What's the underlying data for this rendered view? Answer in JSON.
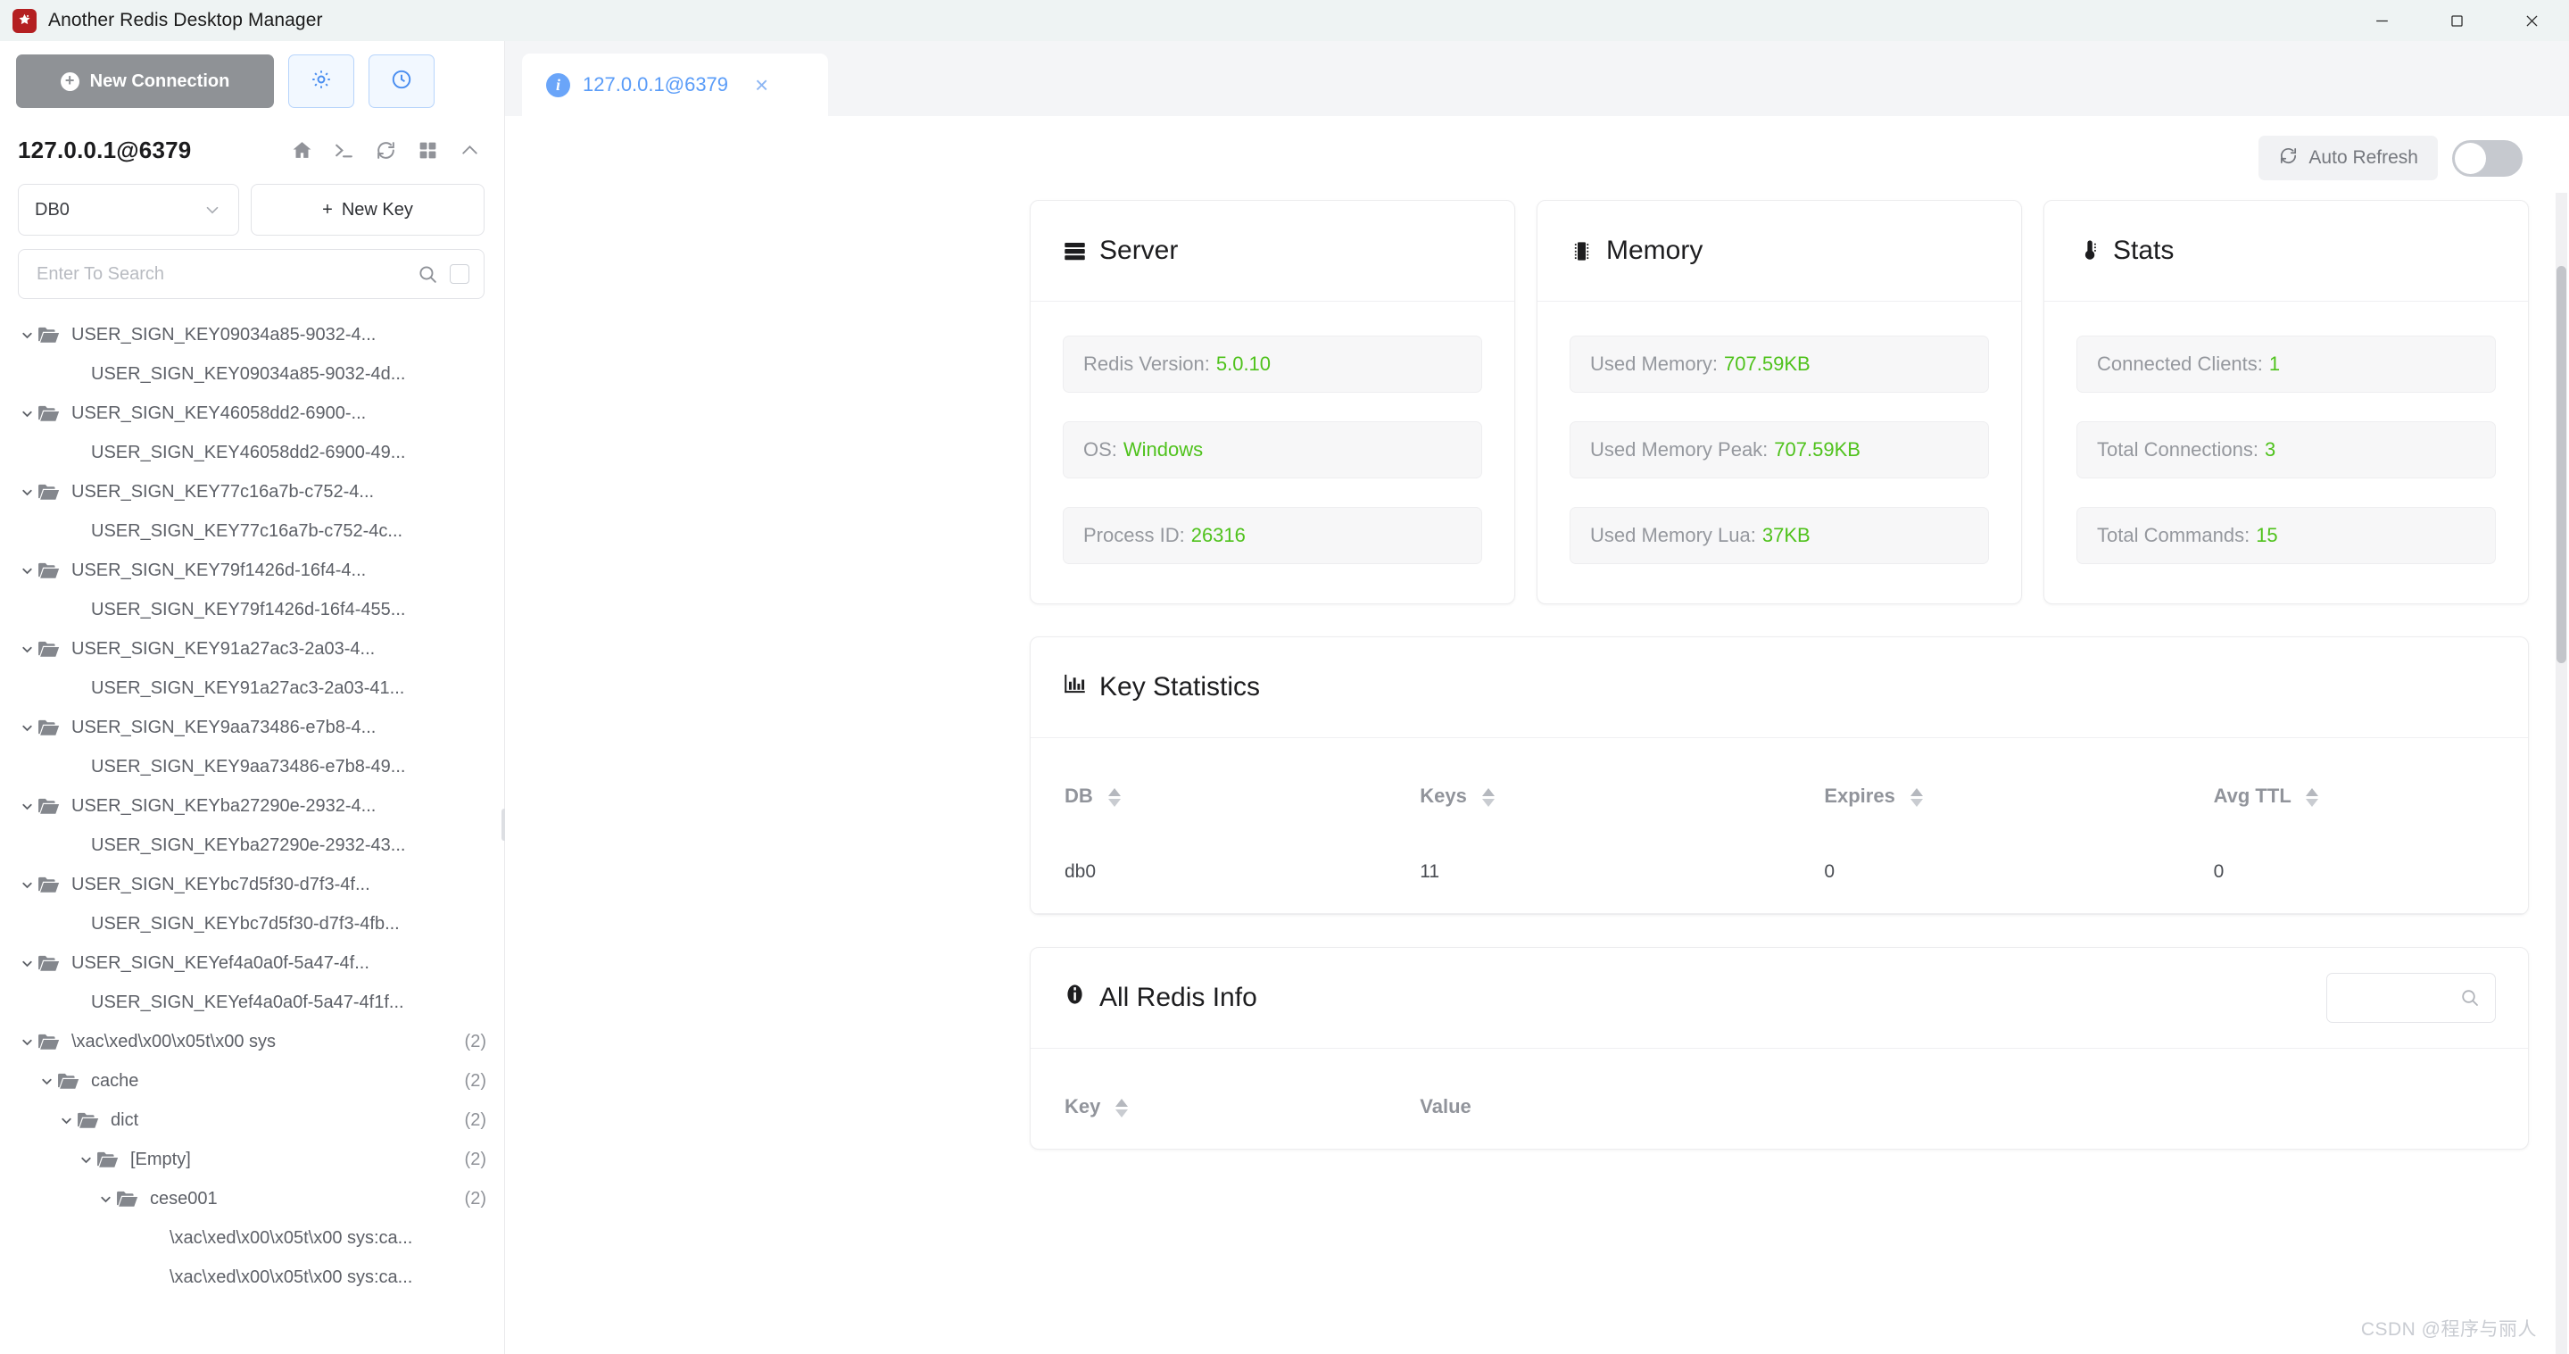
{
  "window": {
    "title": "Another Redis Desktop Manager",
    "controls": {
      "minimize": "minimize-icon",
      "maximize": "maximize-icon",
      "close": "close-icon"
    }
  },
  "sidebar": {
    "new_connection_label": "New Connection",
    "settings_icon": "settings-gear-icon",
    "history_icon": "clock-history-icon",
    "connection_name": "127.0.0.1@6379",
    "connection_icons": [
      "home-icon",
      "console-icon",
      "refresh-icon",
      "grid-icon",
      "chevron-up-icon"
    ],
    "db_selected": "DB0",
    "new_key_label": "New Key",
    "search_placeholder": "Enter To Search",
    "search_value": "",
    "tree": [
      {
        "label": "USER_SIGN_KEY09034a85-9032-4...",
        "type": "folder",
        "depth": 0,
        "expanded": true,
        "count": ""
      },
      {
        "label": "USER_SIGN_KEY09034a85-9032-4d...",
        "type": "key",
        "depth": 1,
        "expanded": false,
        "count": ""
      },
      {
        "label": "USER_SIGN_KEY46058dd2-6900-...",
        "type": "folder",
        "depth": 0,
        "expanded": true,
        "count": ""
      },
      {
        "label": "USER_SIGN_KEY46058dd2-6900-49...",
        "type": "key",
        "depth": 1,
        "expanded": false,
        "count": ""
      },
      {
        "label": "USER_SIGN_KEY77c16a7b-c752-4...",
        "type": "folder",
        "depth": 0,
        "expanded": true,
        "count": ""
      },
      {
        "label": "USER_SIGN_KEY77c16a7b-c752-4c...",
        "type": "key",
        "depth": 1,
        "expanded": false,
        "count": ""
      },
      {
        "label": "USER_SIGN_KEY79f1426d-16f4-4...",
        "type": "folder",
        "depth": 0,
        "expanded": true,
        "count": ""
      },
      {
        "label": "USER_SIGN_KEY79f1426d-16f4-455...",
        "type": "key",
        "depth": 1,
        "expanded": false,
        "count": ""
      },
      {
        "label": "USER_SIGN_KEY91a27ac3-2a03-4...",
        "type": "folder",
        "depth": 0,
        "expanded": true,
        "count": ""
      },
      {
        "label": "USER_SIGN_KEY91a27ac3-2a03-41...",
        "type": "key",
        "depth": 1,
        "expanded": false,
        "count": ""
      },
      {
        "label": "USER_SIGN_KEY9aa73486-e7b8-4...",
        "type": "folder",
        "depth": 0,
        "expanded": true,
        "count": ""
      },
      {
        "label": "USER_SIGN_KEY9aa73486-e7b8-49...",
        "type": "key",
        "depth": 1,
        "expanded": false,
        "count": ""
      },
      {
        "label": "USER_SIGN_KEYba27290e-2932-4...",
        "type": "folder",
        "depth": 0,
        "expanded": true,
        "count": ""
      },
      {
        "label": "USER_SIGN_KEYba27290e-2932-43...",
        "type": "key",
        "depth": 1,
        "expanded": false,
        "count": ""
      },
      {
        "label": "USER_SIGN_KEYbc7d5f30-d7f3-4f...",
        "type": "folder",
        "depth": 0,
        "expanded": true,
        "count": ""
      },
      {
        "label": "USER_SIGN_KEYbc7d5f30-d7f3-4fb...",
        "type": "key",
        "depth": 1,
        "expanded": false,
        "count": ""
      },
      {
        "label": "USER_SIGN_KEYef4a0a0f-5a47-4f...",
        "type": "folder",
        "depth": 0,
        "expanded": true,
        "count": ""
      },
      {
        "label": "USER_SIGN_KEYef4a0a0f-5a47-4f1f...",
        "type": "key",
        "depth": 1,
        "expanded": false,
        "count": ""
      },
      {
        "label": "\\xac\\xed\\x00\\x05t\\x00 sys",
        "type": "folder",
        "depth": 0,
        "expanded": true,
        "count": "(2)"
      },
      {
        "label": "cache",
        "type": "folder",
        "depth": 1,
        "expanded": true,
        "count": "(2)"
      },
      {
        "label": "dict",
        "type": "folder",
        "depth": 2,
        "expanded": true,
        "count": "(2)"
      },
      {
        "label": "[Empty]",
        "type": "folder",
        "depth": 3,
        "expanded": true,
        "count": "(2)"
      },
      {
        "label": "cese001",
        "type": "folder",
        "depth": 4,
        "expanded": true,
        "count": "(2)"
      },
      {
        "label": "\\xac\\xed\\x00\\x05t\\x00 sys:ca...",
        "type": "key",
        "depth": 5,
        "expanded": false,
        "count": ""
      },
      {
        "label": "\\xac\\xed\\x00\\x05t\\x00 sys:ca...",
        "type": "key",
        "depth": 5,
        "expanded": false,
        "count": ""
      }
    ]
  },
  "tabs": [
    {
      "label": "127.0.0.1@6379",
      "icon": "info-icon",
      "close": "×",
      "active": true
    }
  ],
  "toolbar": {
    "auto_refresh_label": "Auto Refresh",
    "auto_refresh_icon": "refresh-icon",
    "auto_refresh_on": false
  },
  "cards": [
    {
      "title": "Server",
      "icon": "server-icon",
      "rows": [
        {
          "label": "Redis Version:",
          "value": "5.0.10"
        },
        {
          "label": "OS:",
          "value": "Windows"
        },
        {
          "label": "Process ID:",
          "value": "26316"
        }
      ]
    },
    {
      "title": "Memory",
      "icon": "memory-chip-icon",
      "rows": [
        {
          "label": "Used Memory:",
          "value": "707.59KB"
        },
        {
          "label": "Used Memory Peak:",
          "value": "707.59KB"
        },
        {
          "label": "Used Memory Lua:",
          "value": "37KB"
        }
      ]
    },
    {
      "title": "Stats",
      "icon": "thermometer-icon",
      "rows": [
        {
          "label": "Connected Clients:",
          "value": "1"
        },
        {
          "label": "Total Connections:",
          "value": "3"
        },
        {
          "label": "Total Commands:",
          "value": "15"
        }
      ]
    }
  ],
  "key_statistics": {
    "title": "Key Statistics",
    "icon": "bar-chart-icon",
    "columns": [
      "DB",
      "Keys",
      "Expires",
      "Avg TTL"
    ],
    "rows": [
      {
        "db": "db0",
        "keys": "11",
        "expires": "0",
        "avg_ttl": "0"
      }
    ]
  },
  "all_redis_info": {
    "title": "All Redis Info",
    "icon": "info-icon",
    "search_value": "",
    "search_icon": "search-icon",
    "columns": [
      "Key",
      "Value"
    ],
    "rows": []
  },
  "watermark": "CSDN @程序与丽人",
  "colors": {
    "accent_blue": "#5a9cf8",
    "value_green": "#4fc21c",
    "brand_red": "#b41f21",
    "muted": "#91949b"
  }
}
